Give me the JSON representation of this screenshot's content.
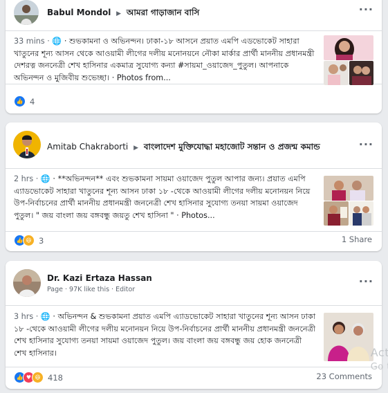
{
  "posts": [
    {
      "author": "Babul Mondol",
      "group": "আমরা গাড়াজান বাসি",
      "time": "33 mins ·",
      "body": "🌐 · শুভকামনা ও অভিনন্দন। ঢাকা-১৮ আসনে প্রয়াত এমপি এডভোকেট সাহারা খাতুনের শূন্য আসন থেকে আওয়ামী লীগের দলীয় মনোনয়নে নৌকা মার্কার প্রার্থী মাননীয় প্রধানমন্ত্রী দেশরত্ন জননেত্রী শেখ হাসিনার একমাত্র সুযোগ্য কন্যা #সায়মা_ওয়াজেদ_পুতুল। আপনাকে অভিনন্দন ও মুজিবীয় শুভেচ্ছা। · Photos from...",
      "reaction_count": "4"
    },
    {
      "author": "Amitab Chakraborti",
      "group": "বাংলাদেশ মুক্তিযোদ্ধা মহাজোট সন্তান ও প্রজন্ম কমান্ড",
      "time": "2 hrs ·",
      "body": "🌐 · **অভিনন্দন** এবং শুভকামনা সায়মা ওয়াজেদ পুতুল আপার জন্য। প্রয়াত এমপি এ্যাডভোকেট সাহারা খাতুনের শূন্য আসন ঢাকা ১৮ -থেকে আওয়ামী লীগের দলীয় মনোনয়ন নিয়ে উপ-নির্বাচনের প্রার্থী মাননীয় প্রধানমন্ত্রী জননেত্রী শেখ হাসিনার সুযোগ্য তনয়া সায়মা ওয়াজেদ পুতুল। \" জয় বাংলা জয় বঙ্গবন্ধু জয়তু শেখ হাসিনা \" · Photos...",
      "reaction_count": "3",
      "share_count": "1 Share"
    },
    {
      "author": "Dr. Kazi Ertaza Hassan",
      "meta": "Page · 97K like this · Editor",
      "time": "3 hrs ·",
      "body": "🌐 · অভিনন্দন & শুভকামনা প্রয়াত এমপি এ্যাডভোকেট সাহারা খাতুনের শূন্য আসন ঢাকা ১৮ -থেকে আওয়ামী লীগের দলীয় মনোনয়ন নিয়ে উপ-নির্বাচনের প্রার্থী মাননীয় প্রধানমন্ত্রী জননেত্রী শেখ হাসিনার সুযোগ্য তনয়া সায়মা ওয়াজেদ পুতুল। জয় বাংলা জয় বঙ্গবন্ধু জয় হোক জননেত্রী শেখ হাসিনার।",
      "reaction_count": "418",
      "comment_count": "23 Comments"
    }
  ],
  "watermark": {
    "line1": "Act",
    "line2": "Go t"
  },
  "colors": {
    "background": "#e9ebee",
    "like": "#1877f2",
    "haha": "#f7b125",
    "love": "#f33e58",
    "meta": "#606770"
  },
  "icons": {
    "globe": "globe-icon",
    "arrow": "triangle-right-icon",
    "more": "more-dots-icon"
  }
}
